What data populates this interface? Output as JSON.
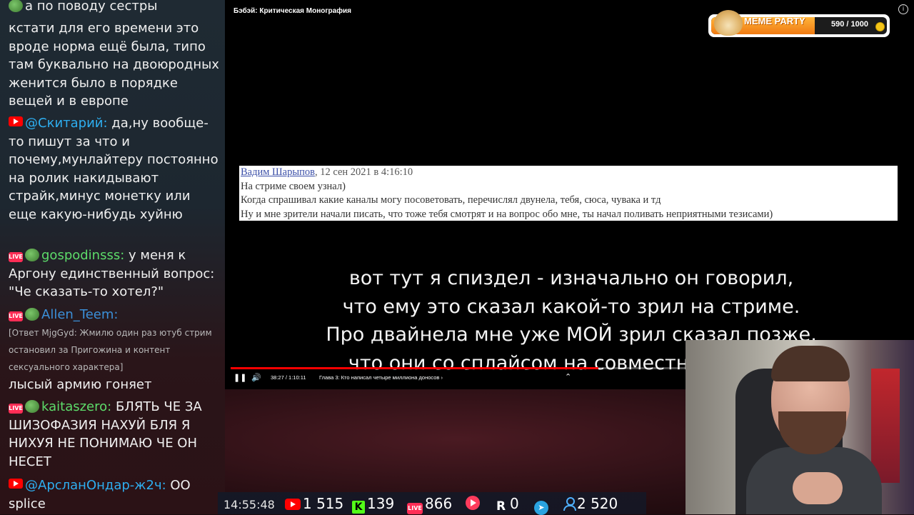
{
  "chat": {
    "messages": [
      {
        "text": "а по поводу сестры"
      },
      {
        "text": "кстати для его времени это вроде норма ещё была, типо там буквально на двоюродных женится было в порядке вещей и в европе"
      },
      {
        "author": "@Скитарий:",
        "text": "да,ну вообще-то пишут за что и почему,мунлайтеру постоянно на ролик накидывают страйк,минус монетку или еще какую-нибудь хуйню"
      },
      {
        "author": "gospodinsss:",
        "text": "у меня к Аргону единственный вопрос: \"Че сказать-то хотел?\""
      },
      {
        "author": "Allen_Teem:",
        "reply": "[Ответ MjgGyd: Жмилю один раз ютуб стрим остановил за Пригожина и контент сексуального характера]",
        "text": "лысый армию гоняет"
      },
      {
        "author": "kaitaszero:",
        "text": "БЛЯТЬ ЧЕ ЗА ШИЗОФАЗИЯ НАХУЙ БЛЯ Я НИХУЯ НЕ ПОНИМАЮ ЧЕ ОН НЕСЕТ"
      },
      {
        "author": "@АрсланОндар-ж2ч:",
        "text": "ОО splice"
      }
    ],
    "badge_live_label": "LIVE"
  },
  "video": {
    "title": "Бэбэй: Критическая Монография",
    "info_icon": "i",
    "screenshot": {
      "author": "Вадим Шарыпов",
      "date": ", 12 сен 2021 в 4:16:10",
      "lines": [
        "На стриме своем узнал)",
        "Когда спрашивал какие каналы могу посоветовать, перечислял двунела, тебя, сюса, чувака и тд",
        "Ну и мне зрители начали писать, что тоже тебя смотрят и на вопрос обо мне, ты начал поливать неприятными тезисами)"
      ]
    },
    "subtitles": [
      "вот тут я спиздел - изначально он говорил,",
      "что ему это сказал какой-то зрил на стриме.",
      "Про двайнела мне уже МОЙ зрил сказал позже,",
      "что они со сплайсом на совместном стриме"
    ],
    "player": {
      "time": "38:27 / 1:10:11",
      "chapter": "Глава 3: Кто написал четыре миллиона доносов ›",
      "progress": 0.548,
      "play_icon": "❚❚",
      "volume_icon": "🔊",
      "expand_icon": "⌃"
    }
  },
  "meme_party": {
    "title": "MEME PARTY",
    "count": "590 / 1000",
    "progress": 0.59
  },
  "stats": {
    "clock": "14:55:48",
    "youtube": "1 515",
    "kick": "139",
    "kick_letter": "K",
    "live": "866",
    "live_label": "LIVE",
    "rutube": "0",
    "r_letter": "R",
    "telegram_glyph": "➤",
    "viewers": "2 520"
  },
  "colors": {
    "youtube_red": "#ff0000",
    "kick_green": "#53fc18",
    "live_pink": "#ff2d55",
    "telegram_blue": "#2aa3e0",
    "meme_orange": "#f07a12"
  }
}
